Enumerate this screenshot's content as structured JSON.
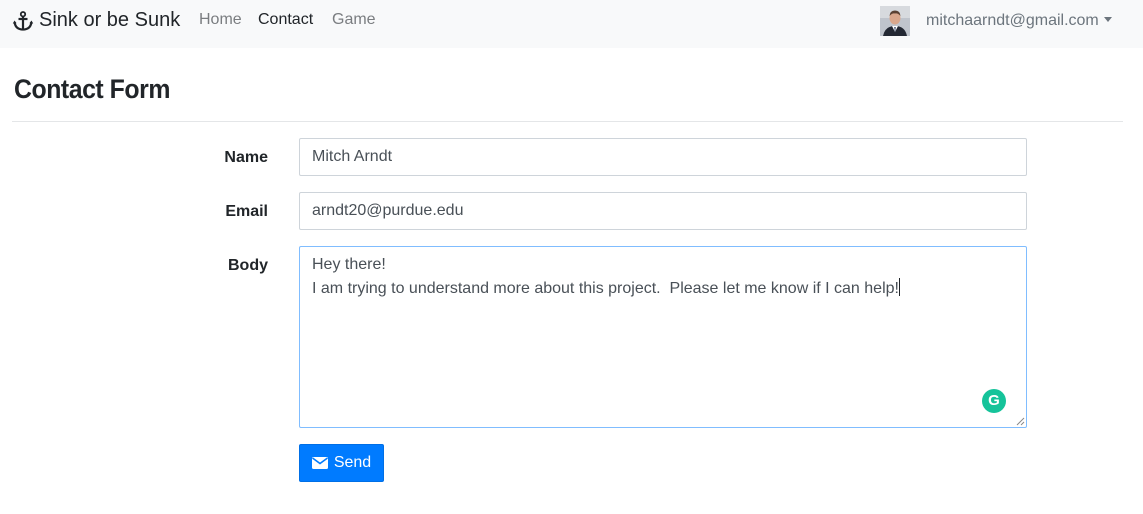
{
  "nav": {
    "brand": "Sink or be Sunk",
    "brand_icon": "anchor-icon",
    "links": [
      {
        "label": "Home",
        "active": false
      },
      {
        "label": "Contact",
        "active": true
      },
      {
        "label": "Game",
        "active": false
      }
    ],
    "user_email": "mitchaarndt@gmail.com"
  },
  "page": {
    "title": "Contact Form"
  },
  "form": {
    "name_label": "Name",
    "name_value": "Mitch Arndt",
    "email_label": "Email",
    "email_value": "arndt20@purdue.edu",
    "body_label": "Body",
    "body_value": "Hey there!\nI am trying to understand more about this project.  Please let me know if I can help!",
    "send_label": "Send",
    "send_icon": "envelope-icon"
  },
  "colors": {
    "navbar_bg": "#f8f9fa",
    "primary": "#007bff",
    "focus_border": "#80bdff",
    "grammarly": "#15c39a"
  }
}
